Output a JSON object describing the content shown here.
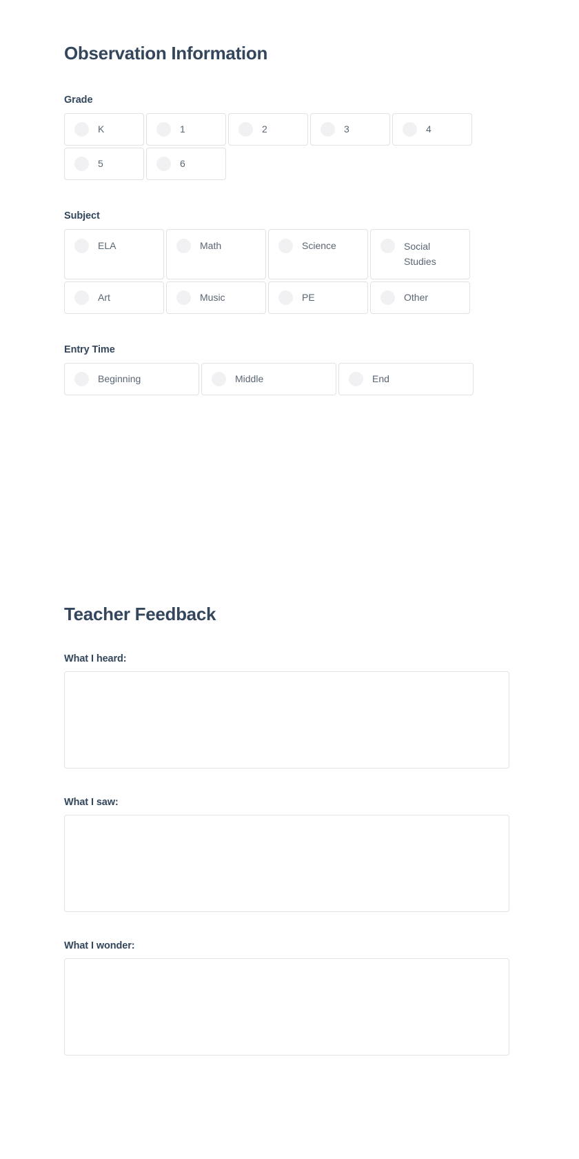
{
  "sections": {
    "observation": {
      "title": "Observation Information",
      "fields": [
        {
          "label": "Grade",
          "name": "grade",
          "options": [
            "K",
            "1",
            "2",
            "3",
            "4",
            "5",
            "6"
          ]
        },
        {
          "label": "Subject",
          "name": "subject",
          "options": [
            "ELA",
            "Math",
            "Science",
            "Social Studies",
            "Art",
            "Music",
            "PE",
            "Other"
          ]
        },
        {
          "label": "Entry Time",
          "name": "entry_time",
          "options": [
            "Beginning",
            "Middle",
            "End"
          ]
        }
      ]
    },
    "feedback": {
      "title": "Teacher Feedback",
      "textareas": [
        {
          "label": "What I heard:",
          "value": "",
          "placeholder": ""
        },
        {
          "label": "What I saw:",
          "value": "",
          "placeholder": ""
        },
        {
          "label": "What I wonder:",
          "value": "",
          "placeholder": ""
        }
      ]
    }
  },
  "colors": {
    "heading": "#33465c",
    "label_text": "#5a6573",
    "border": "#dfe1e5",
    "radio_fill": "#f1f1f3",
    "background": "#ffffff"
  }
}
